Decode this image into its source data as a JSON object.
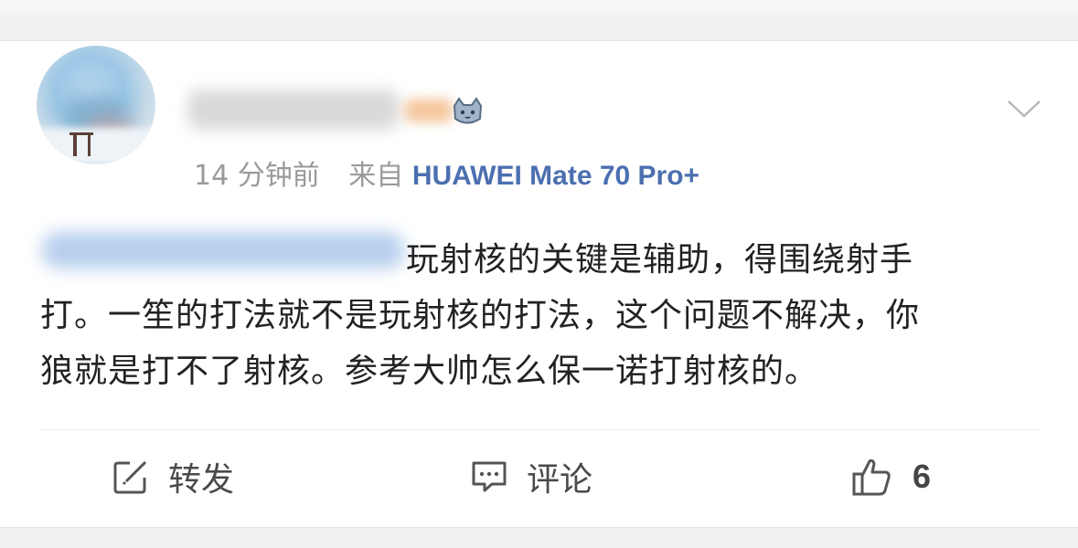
{
  "post": {
    "time": "14 分钟前",
    "source_prefix": "来自",
    "device": "HUAWEI Mate 70 Pro+",
    "content_lines": [
      "玩射核的关键是辅助，得围绕射手",
      "打。一笙的打法就不是玩射核的打法，这个问题不解决，你",
      "狼就是打不了射核。参考大帅怎么保一诺打射核的。"
    ]
  },
  "actions": {
    "repost_label": "转发",
    "comment_label": "评论",
    "like_count": "6"
  },
  "colors": {
    "device_link": "#4b6fb0",
    "meta_text": "#9a9a9a",
    "body_text": "#222222"
  }
}
